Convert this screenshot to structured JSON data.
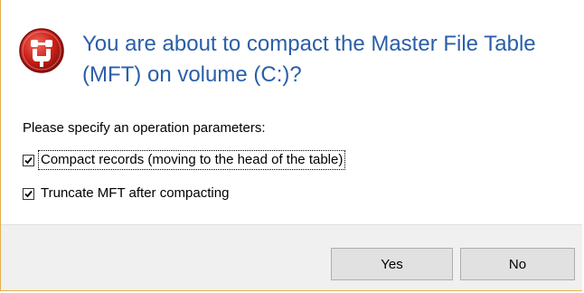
{
  "dialog": {
    "heading": "You are about to compact the Master File Table (MFT) on volume (C:)?",
    "params_label": "Please specify an operation parameters:",
    "options": [
      {
        "label": "Compact records (moving to the head of the table)",
        "checked": true
      },
      {
        "label": "Truncate MFT after compacting",
        "checked": true
      }
    ],
    "buttons": {
      "yes": "Yes",
      "no": "No"
    }
  },
  "icons": {
    "header": "warning-icon"
  },
  "colors": {
    "heading": "#2a5fa8",
    "icon_red": "#c8201e",
    "border": "#e3b04a",
    "footer_bg": "#f0f0f0",
    "button_bg": "#e1e1e1",
    "button_border": "#adadad"
  }
}
